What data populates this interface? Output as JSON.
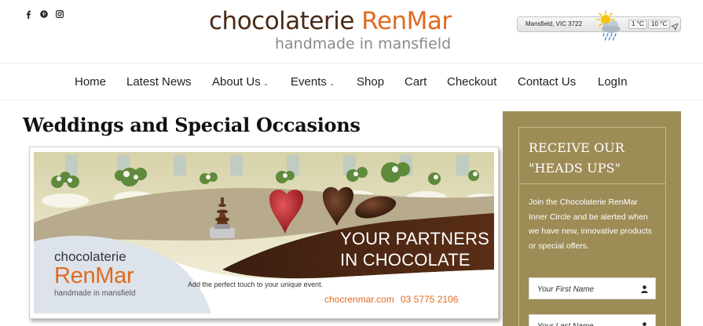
{
  "social": [
    {
      "icon": "facebook-icon",
      "label": "f"
    },
    {
      "icon": "pinterest-icon",
      "label": "p"
    },
    {
      "icon": "instagram-icon",
      "label": "i"
    }
  ],
  "logo": {
    "line1_a": "chocolaterie ",
    "line1_b": "RenMar",
    "line2": "handmade in mansfield"
  },
  "weather": {
    "location": "Mansfield, VIC 3722",
    "icon": "partly-cloudy-rain-icon",
    "temp_low": "1 °C",
    "temp_high": "10 °C",
    "locate_icon": "location-arrow-icon"
  },
  "nav": {
    "items": [
      {
        "label": "Home"
      },
      {
        "label": "Latest News"
      },
      {
        "label": "About Us",
        "caret": "⌄"
      },
      {
        "label": "Events",
        "caret": "⌄"
      },
      {
        "label": "Shop"
      },
      {
        "label": "Cart"
      },
      {
        "label": "Checkout"
      },
      {
        "label": "Contact Us"
      },
      {
        "label": "LogIn"
      }
    ]
  },
  "main": {
    "title": "Weddings and Special Occasions",
    "banner": {
      "headline_1": "YOUR PARTNERS",
      "headline_2": "IN CHOCOLATE",
      "brand_1": "chocolaterie",
      "brand_2": "RenMar",
      "brand_3": "handmade in mansfield",
      "tagline": "Add the perfect touch to your unique event.",
      "website": "chocrenmar.com",
      "phone": "03 5775 2106"
    }
  },
  "sidebar": {
    "title_1": "RECEIVE OUR",
    "title_2": "\"HEADS UPS\"",
    "body_lines": [
      "Join the Chocolaterie RenMar",
      "Inner Circle and be alerted when",
      "we have new, innovative products",
      "or special offers."
    ],
    "first_name_placeholder": "Your First Name",
    "last_name_placeholder": "Your Last Name"
  },
  "colors": {
    "brand_brown": "#4a2a17",
    "brand_orange": "#e06a20",
    "sidebar_bg": "#9d8c56"
  }
}
